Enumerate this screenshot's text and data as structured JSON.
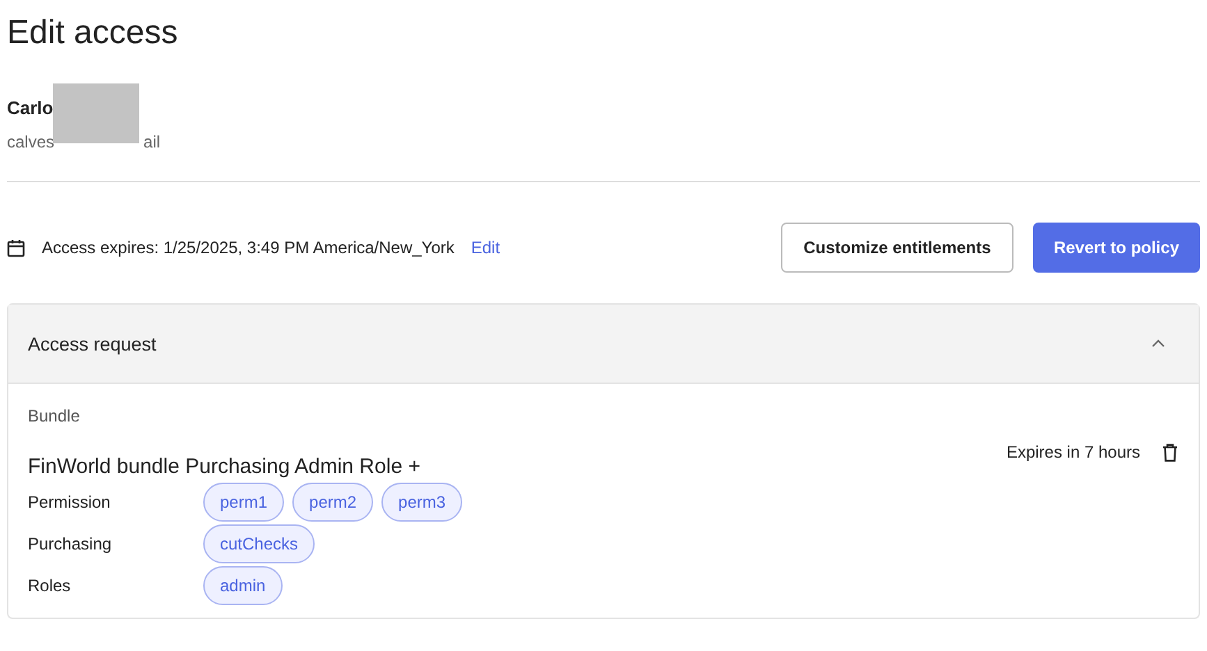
{
  "page_title": "Edit access",
  "user": {
    "name": "Carlo",
    "email_start": "calves",
    "email_end": "ail",
    "redacted": true
  },
  "access": {
    "expires_label": "Access expires: 1/25/2025, 3:49 PM America/New_York",
    "edit_link": "Edit"
  },
  "buttons": [
    {
      "label": "Customize entitlements",
      "kind": "secondary"
    },
    {
      "label": "Revert to policy",
      "kind": "primary"
    }
  ],
  "request_card": {
    "title": "Access request",
    "expanded": true,
    "type_label": "Bundle",
    "bundle_name": "FinWorld bundle Purchasing Admin Role +",
    "expiry": "Expires in 7 hours",
    "groups": [
      {
        "label": "Permission",
        "tags": [
          "perm1",
          "perm2",
          "perm3"
        ]
      },
      {
        "label": "Purchasing",
        "tags": [
          "cutChecks"
        ]
      },
      {
        "label": "Roles",
        "tags": [
          "admin"
        ]
      }
    ]
  }
}
